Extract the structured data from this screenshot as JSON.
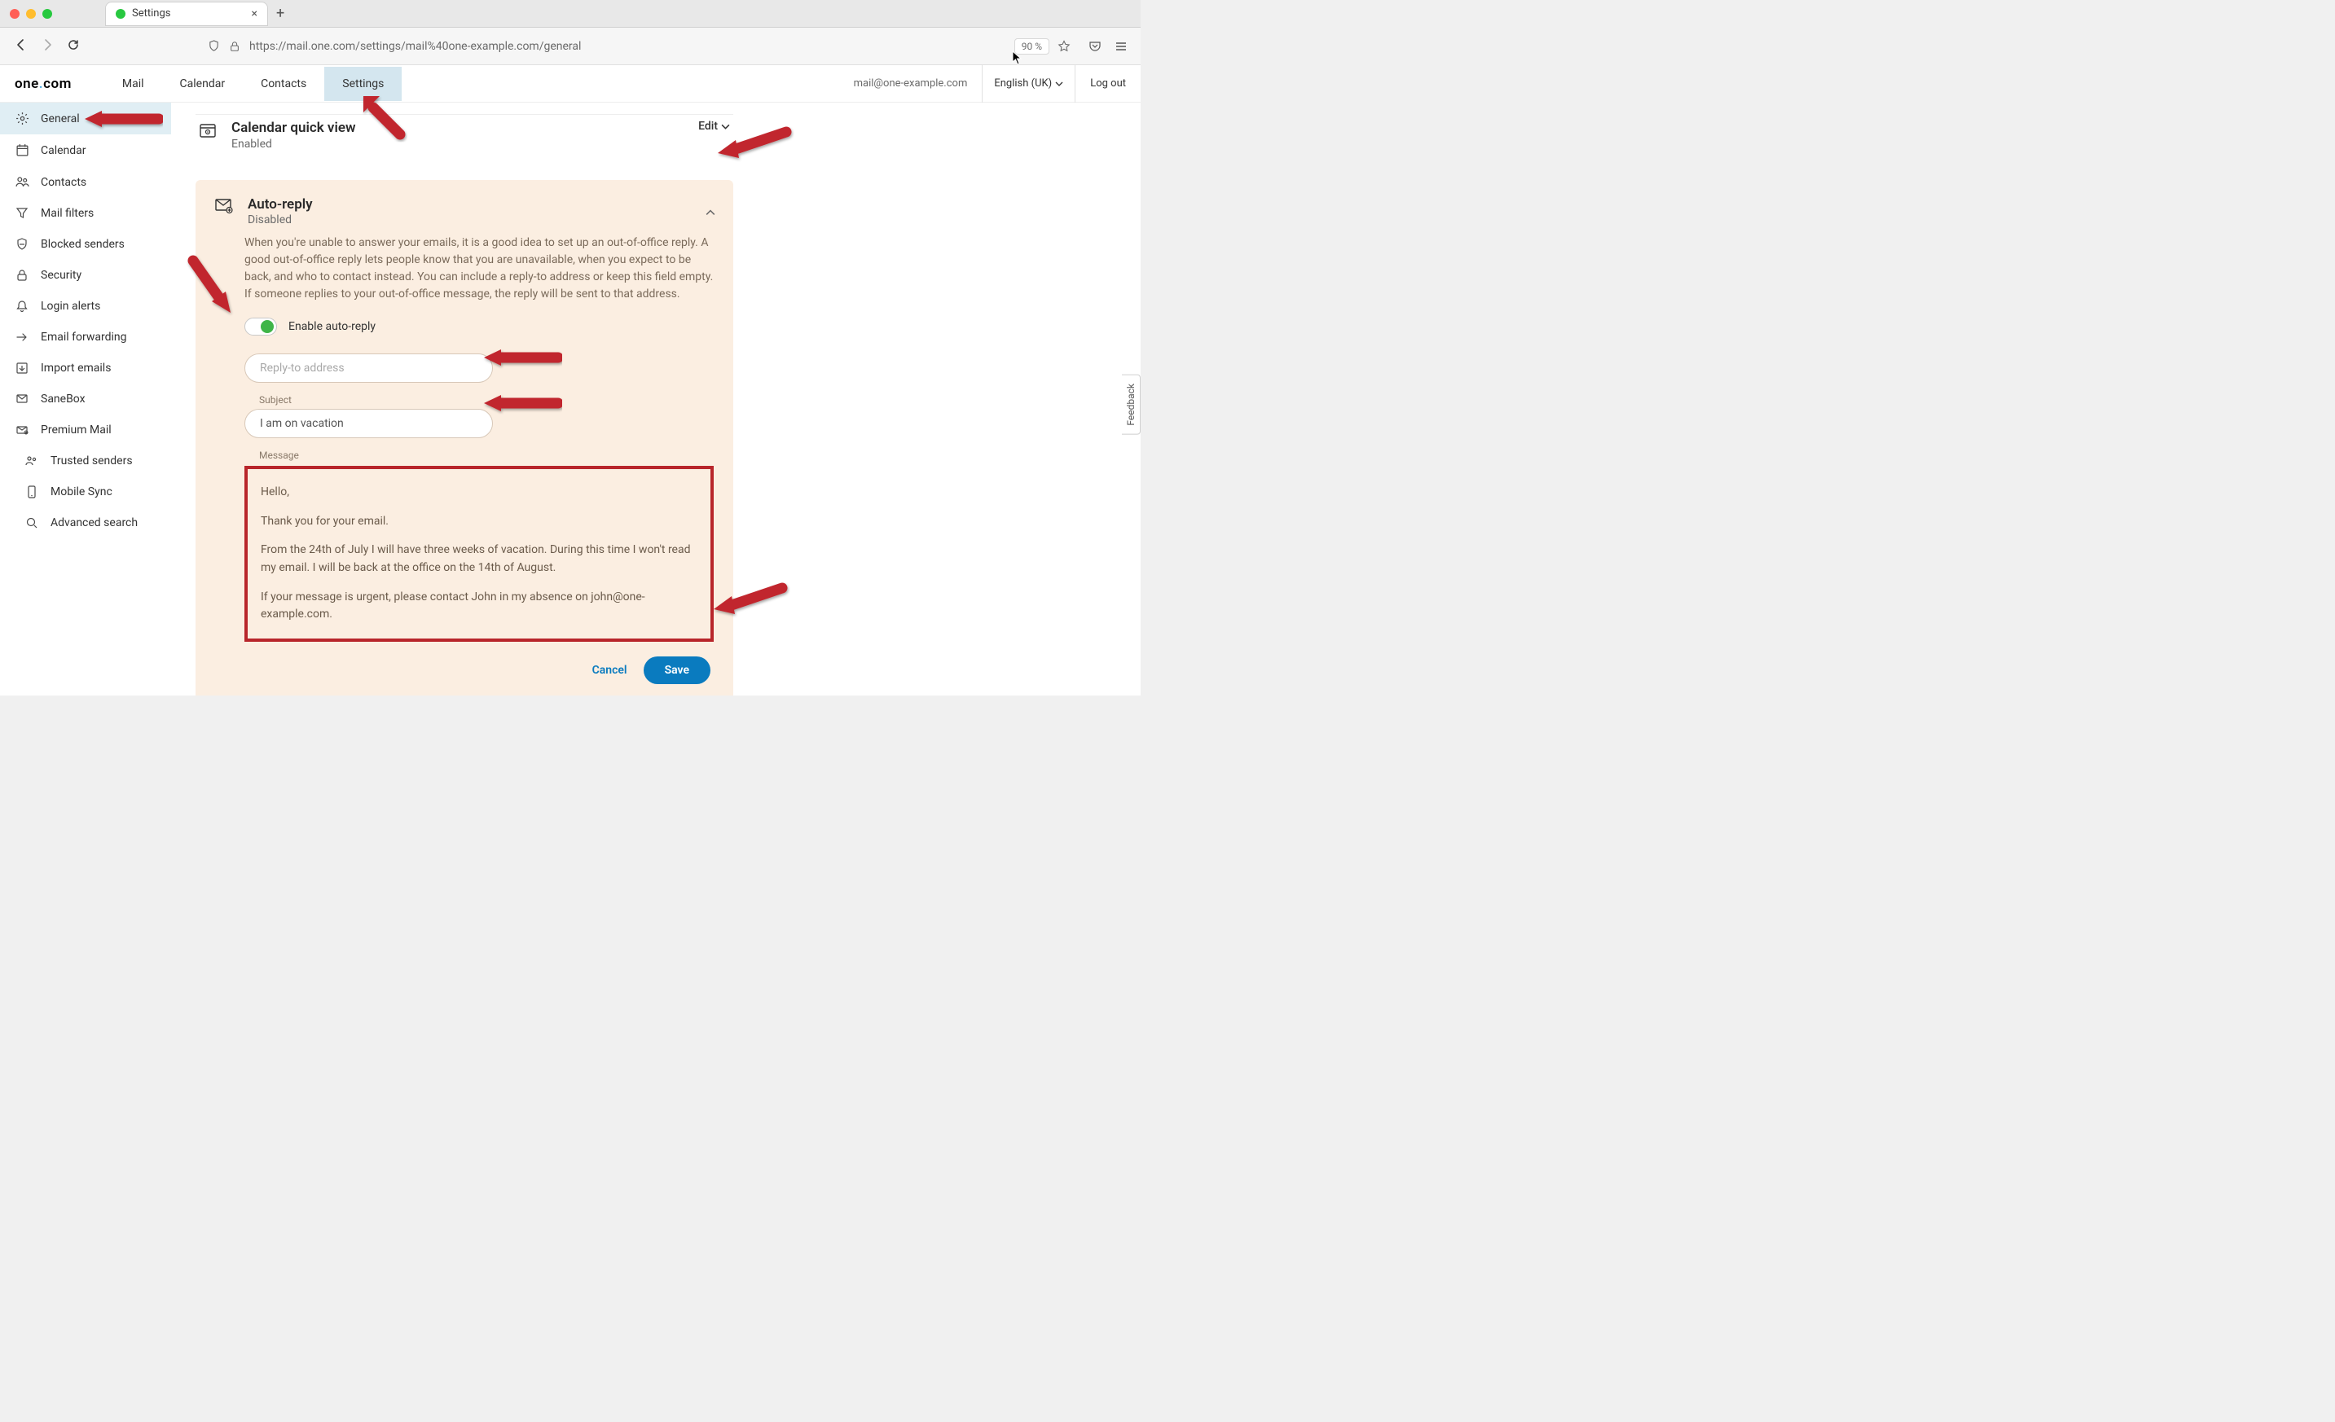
{
  "browser": {
    "tab_title": "Settings",
    "url_display": "https://mail.one.com/settings/mail%40one-example.com/general",
    "zoom": "90 %"
  },
  "header": {
    "logo_text_1": "one",
    "logo_text_2": "com",
    "nav": {
      "mail": "Mail",
      "calendar": "Calendar",
      "contacts": "Contacts",
      "settings": "Settings"
    },
    "account_email": "mail@one-example.com",
    "language": "English (UK)",
    "logout": "Log out"
  },
  "sidebar": {
    "items": [
      {
        "label": "General"
      },
      {
        "label": "Calendar"
      },
      {
        "label": "Contacts"
      },
      {
        "label": "Mail filters"
      },
      {
        "label": "Blocked senders"
      },
      {
        "label": "Security"
      },
      {
        "label": "Login alerts"
      },
      {
        "label": "Email forwarding"
      },
      {
        "label": "Import emails"
      },
      {
        "label": "SaneBox"
      },
      {
        "label": "Premium Mail"
      },
      {
        "label": "Trusted senders"
      },
      {
        "label": "Mobile Sync"
      },
      {
        "label": "Advanced search"
      }
    ]
  },
  "calendar_quick_view": {
    "title": "Calendar quick view",
    "status": "Enabled",
    "edit_label": "Edit"
  },
  "auto_reply": {
    "title": "Auto-reply",
    "status": "Disabled",
    "description": "When you're unable to answer your emails, it is a good idea to set up an out-of-office reply. A good out-of-office reply lets people know that you are unavailable, when you expect to be back, and who to contact instead. You can include a reply-to address or keep this field empty. If someone replies to your out-of-office message, the reply will be sent to that address.",
    "enable_toggle_label": "Enable auto-reply",
    "reply_to_placeholder": "Reply-to address",
    "reply_to_value": "",
    "subject_label": "Subject",
    "subject_value": "I am on vacation",
    "message_label": "Message",
    "message_body": {
      "p1": "Hello,",
      "p2": "Thank you for your email.",
      "p3": "From the 24th of July I will have three weeks of vacation. During this time I won't read my email. I will be back at the office on the 14th of August.",
      "p4": "If your message is urgent, please contact John in my absence on john@one-example.com."
    },
    "cancel_label": "Cancel",
    "save_label": "Save"
  },
  "feedback_tab": "Feedback"
}
